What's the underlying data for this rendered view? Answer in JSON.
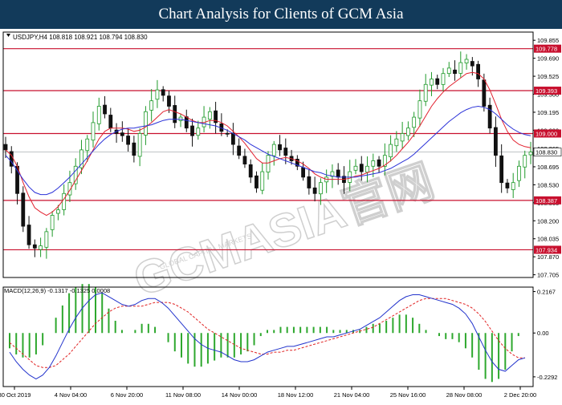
{
  "banner": {
    "title": "Chart Analysis for Clients of GCM Asia"
  },
  "watermark": {
    "text": "GCMASIA官网",
    "subtext": "GLOBAL CAPITAL MARKETS"
  },
  "colors": {
    "banner": "#123a5a",
    "bull": "#1f9a2a",
    "bear": "#111111",
    "ma_red": "#e2202e",
    "ma_blue": "#2b32d8",
    "level": "#c8102e",
    "macd_hist": "#2ea82e",
    "macd_signal": "#e02020",
    "macd_main": "#2233cc",
    "last_price_bg": "#ffffff"
  },
  "chart_data": [
    {
      "type": "candlestick",
      "header": "USDJPY,H4  108.818 108.921 108.794 108.830",
      "ylim": [
        107.68,
        109.93
      ],
      "y_ticks": [
        "109.855",
        "109.690",
        "109.525",
        "109.360",
        "109.195",
        "109.030",
        "108.865",
        "108.695",
        "108.530",
        "108.365",
        "108.200",
        "108.035",
        "107.870",
        "107.705"
      ],
      "x_ticks": [
        "30 Oct 2019",
        "4 Nov 04:00",
        "6 Nov 20:00",
        "11 Nov 08:00",
        "14 Nov 00:00",
        "18 Nov 12:00",
        "21 Nov 04:00",
        "25 Nov 16:00",
        "28 Nov 08:00",
        "2 Dec 20:00"
      ],
      "levels": [
        {
          "value": 109.778,
          "label": "109.778"
        },
        {
          "value": 109.393,
          "label": "109.393"
        },
        {
          "value": 109.0,
          "label": "109.000"
        },
        {
          "value": 108.387,
          "label": "108.387"
        },
        {
          "value": 107.934,
          "label": "107.934"
        }
      ],
      "last_price": {
        "value": 108.83,
        "label": "108.830"
      },
      "series_close": [
        108.85,
        108.7,
        108.45,
        108.15,
        107.98,
        107.95,
        107.97,
        108.1,
        108.25,
        108.3,
        108.45,
        108.55,
        108.7,
        108.85,
        108.95,
        109.1,
        109.25,
        109.18,
        109.05,
        109.0,
        108.98,
        108.9,
        108.8,
        109.0,
        109.2,
        109.3,
        109.4,
        109.35,
        109.25,
        109.1,
        109.15,
        109.05,
        108.98,
        109.05,
        109.15,
        109.2,
        109.1,
        109.02,
        109.0,
        108.9,
        108.8,
        108.72,
        108.6,
        108.5,
        108.65,
        108.8,
        108.9,
        108.85,
        108.8,
        108.75,
        108.7,
        108.6,
        108.5,
        108.45,
        108.55,
        108.6,
        108.65,
        108.6,
        108.55,
        108.65,
        108.7,
        108.65,
        108.7,
        108.75,
        108.7,
        108.8,
        108.9,
        108.95,
        109.0,
        109.05,
        109.15,
        109.3,
        109.45,
        109.5,
        109.45,
        109.55,
        109.6,
        109.55,
        109.65,
        109.68,
        109.62,
        109.5,
        109.25,
        109.05,
        108.8,
        108.55,
        108.5,
        108.55,
        108.7,
        108.8,
        108.83
      ],
      "series_ma_red": [
        108.85,
        108.8,
        108.7,
        108.55,
        108.42,
        108.32,
        108.28,
        108.25,
        108.28,
        108.33,
        108.4,
        108.48,
        108.57,
        108.66,
        108.75,
        108.85,
        108.95,
        109.02,
        109.05,
        109.05,
        109.05,
        109.04,
        109.02,
        109.03,
        109.06,
        109.1,
        109.15,
        109.2,
        109.22,
        109.2,
        109.18,
        109.15,
        109.12,
        109.1,
        109.1,
        109.12,
        109.12,
        109.1,
        109.07,
        109.02,
        108.97,
        108.91,
        108.84,
        108.77,
        108.73,
        108.73,
        108.75,
        108.77,
        108.78,
        108.77,
        108.75,
        108.72,
        108.68,
        108.63,
        108.6,
        108.58,
        108.58,
        108.58,
        108.58,
        108.59,
        108.61,
        108.62,
        108.64,
        108.66,
        108.68,
        108.71,
        108.75,
        108.8,
        108.86,
        108.92,
        108.99,
        109.07,
        109.16,
        109.25,
        109.32,
        109.38,
        109.43,
        109.47,
        109.51,
        109.55,
        109.56,
        109.55,
        109.5,
        109.4,
        109.27,
        109.13,
        109.02,
        108.94,
        108.9,
        108.88,
        108.87
      ],
      "series_ma_blue": [
        108.8,
        108.74,
        108.66,
        108.58,
        108.51,
        108.46,
        108.44,
        108.44,
        108.46,
        108.5,
        108.55,
        108.6,
        108.66,
        108.72,
        108.78,
        108.84,
        108.9,
        108.95,
        108.99,
        109.02,
        109.04,
        109.05,
        109.05,
        109.06,
        109.07,
        109.08,
        109.1,
        109.12,
        109.13,
        109.13,
        109.13,
        109.12,
        109.11,
        109.1,
        109.09,
        109.08,
        109.07,
        109.05,
        109.03,
        109.0,
        108.97,
        108.94,
        108.9,
        108.87,
        108.84,
        108.81,
        108.79,
        108.77,
        108.75,
        108.73,
        108.71,
        108.69,
        108.67,
        108.65,
        108.64,
        108.62,
        108.61,
        108.6,
        108.6,
        108.6,
        108.6,
        108.61,
        108.62,
        108.63,
        108.64,
        108.66,
        108.68,
        108.71,
        108.74,
        108.77,
        108.81,
        108.86,
        108.91,
        108.96,
        109.01,
        109.06,
        109.11,
        109.15,
        109.19,
        109.22,
        109.24,
        109.25,
        109.24,
        109.22,
        109.18,
        109.13,
        109.08,
        109.04,
        109.01,
        108.99,
        108.98
      ]
    },
    {
      "type": "macd",
      "header": "MACD(12,26,9) -0.1317 -0.1325 0.0008",
      "ylim": [
        -0.28,
        0.24
      ],
      "y_ticks": [
        "0.2167",
        "0.00",
        "-0.2292"
      ],
      "series_macd": [
        -0.1,
        -0.15,
        -0.19,
        -0.22,
        -0.24,
        -0.22,
        -0.18,
        -0.12,
        -0.05,
        0.02,
        0.08,
        0.13,
        0.17,
        0.2,
        0.21,
        0.19,
        0.17,
        0.15,
        0.14,
        0.15,
        0.17,
        0.18,
        0.18,
        0.16,
        0.13,
        0.09,
        0.05,
        0.01,
        -0.03,
        -0.06,
        -0.08,
        -0.09,
        -0.1,
        -0.12,
        -0.14,
        -0.15,
        -0.15,
        -0.14,
        -0.12,
        -0.1,
        -0.09,
        -0.08,
        -0.07,
        -0.07,
        -0.06,
        -0.05,
        -0.04,
        -0.03,
        -0.02,
        -0.02,
        -0.01,
        0.0,
        0.01,
        0.02,
        0.04,
        0.06,
        0.08,
        0.11,
        0.14,
        0.17,
        0.19,
        0.2,
        0.2,
        0.19,
        0.18,
        0.17,
        0.16,
        0.15,
        0.13,
        0.1,
        0.05,
        -0.02,
        -0.09,
        -0.15,
        -0.19,
        -0.2,
        -0.17,
        -0.14,
        -0.13
      ],
      "series_signal": [
        -0.05,
        -0.08,
        -0.11,
        -0.14,
        -0.17,
        -0.18,
        -0.18,
        -0.17,
        -0.14,
        -0.11,
        -0.07,
        -0.03,
        0.01,
        0.05,
        0.08,
        0.11,
        0.13,
        0.14,
        0.14,
        0.14,
        0.14,
        0.15,
        0.16,
        0.16,
        0.16,
        0.15,
        0.13,
        0.11,
        0.08,
        0.05,
        0.02,
        0.0,
        -0.02,
        -0.04,
        -0.06,
        -0.08,
        -0.09,
        -0.1,
        -0.11,
        -0.11,
        -0.1,
        -0.1,
        -0.09,
        -0.09,
        -0.08,
        -0.07,
        -0.06,
        -0.05,
        -0.04,
        -0.03,
        -0.02,
        -0.01,
        0.0,
        0.01,
        0.02,
        0.03,
        0.05,
        0.07,
        0.09,
        0.11,
        0.13,
        0.15,
        0.17,
        0.18,
        0.18,
        0.18,
        0.18,
        0.17,
        0.16,
        0.15,
        0.13,
        0.1,
        0.06,
        0.01,
        -0.04,
        -0.08,
        -0.11,
        -0.13,
        -0.13
      ]
    }
  ]
}
